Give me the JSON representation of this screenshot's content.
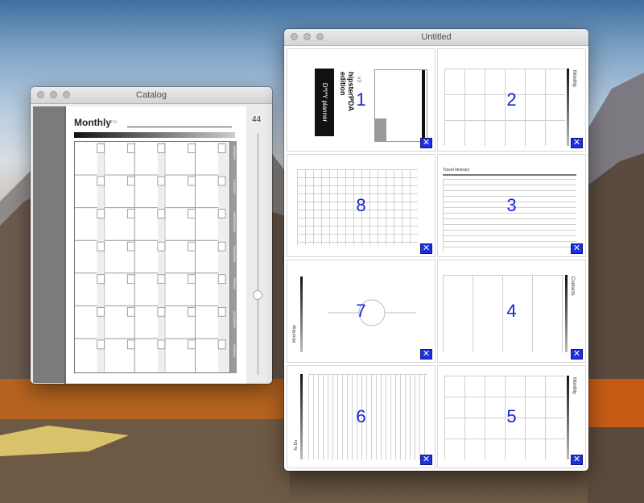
{
  "catalog_window": {
    "title": "Catalog",
    "slider_value": "44",
    "page": {
      "title": "Monthly",
      "subtitle": "LFM",
      "days": [
        "MONDAY",
        "TUESDAY",
        "WEDNESDAY",
        "THURSDAY",
        "FRIDAY",
        "SATURDAY",
        "SUNDAY"
      ]
    }
  },
  "untitled_window": {
    "title": "Untitled",
    "tiles": [
      {
        "number": "1",
        "label_brand": "D*I*Y planner",
        "label_edition": "hipsterPDA edition",
        "label_version": "v3"
      },
      {
        "number": "2",
        "label": "Monthly"
      },
      {
        "number": "8"
      },
      {
        "number": "3",
        "label": "Travel Itinerary"
      },
      {
        "number": "7",
        "label": "Mind Map"
      },
      {
        "number": "4",
        "label": "Contacts"
      },
      {
        "number": "6",
        "label": "To Do"
      },
      {
        "number": "5",
        "label": "Monthly"
      }
    ],
    "close_glyph": "✕"
  }
}
